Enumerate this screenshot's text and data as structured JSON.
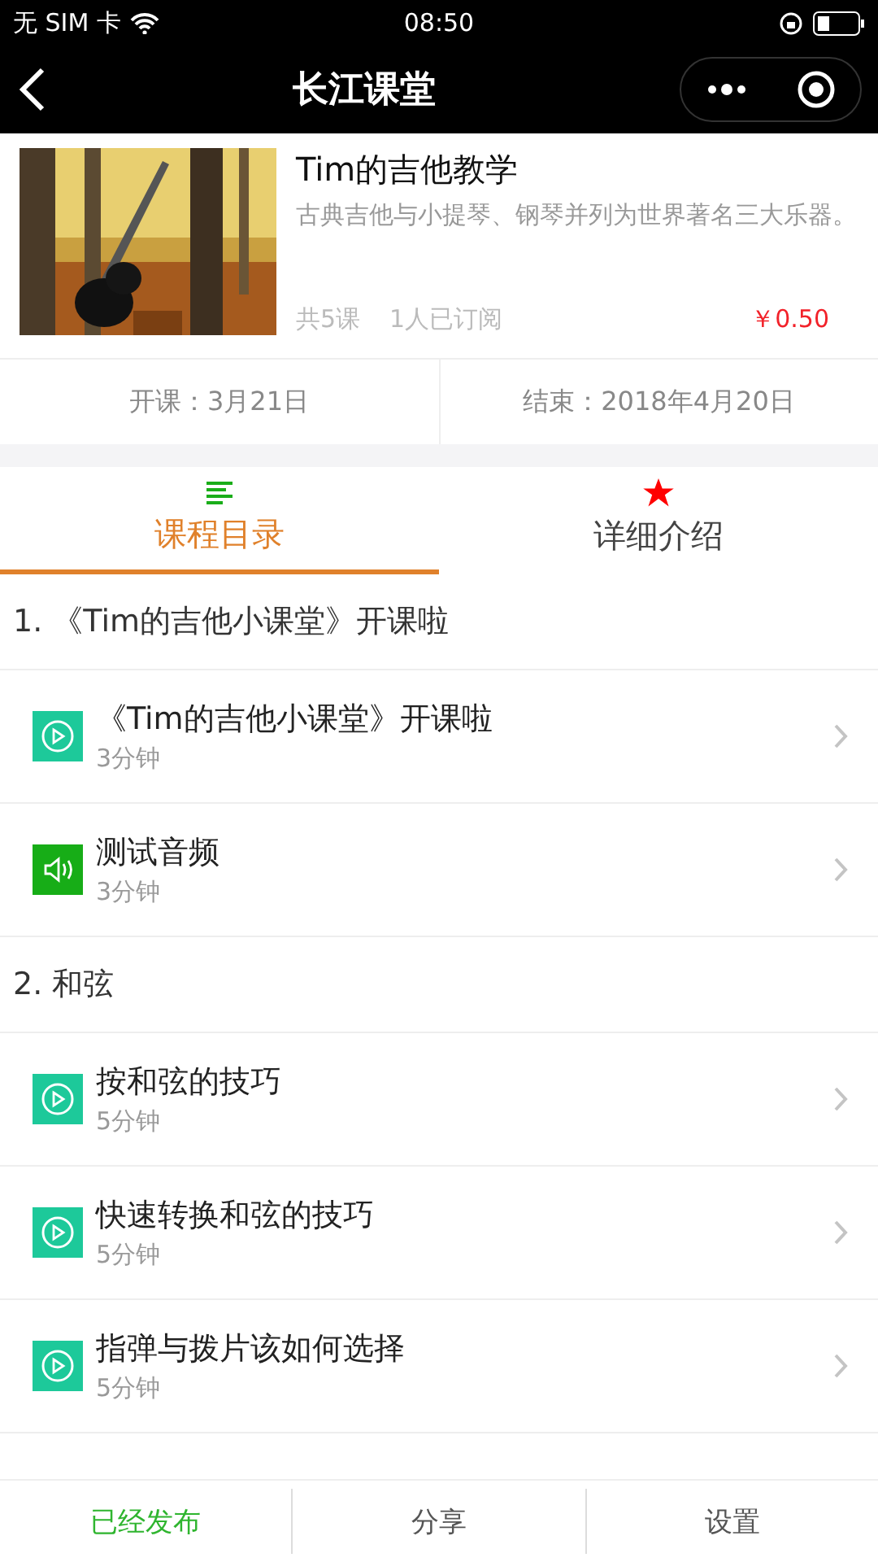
{
  "status_bar": {
    "carrier": "无 SIM 卡",
    "time": "08:50"
  },
  "nav": {
    "title": "长江课堂"
  },
  "course": {
    "title": "Tim的吉他教学",
    "description": "古典吉他与小提琴、钢琴并列为世界著名三大乐器。",
    "lessons": "共5课",
    "subscribers": "1人已订阅",
    "price": "￥0.50"
  },
  "dates": {
    "start": "开课：3月21日",
    "end": "结束：2018年4月20日"
  },
  "tabs": [
    {
      "label": "课程目录",
      "kind": "list",
      "selected": true
    },
    {
      "label": "详细介绍",
      "kind": "star",
      "selected": false
    }
  ],
  "sections": [
    {
      "title": "1. 《Tim的吉他小课堂》开课啦",
      "items": [
        {
          "kind": "video",
          "title": "《Tim的吉他小课堂》开课啦",
          "duration": "3分钟"
        },
        {
          "kind": "audio",
          "title": "测试音频",
          "duration": "3分钟"
        }
      ]
    },
    {
      "title": "2. 和弦",
      "items": [
        {
          "kind": "video",
          "title": "按和弦的技巧",
          "duration": "5分钟"
        },
        {
          "kind": "video",
          "title": "快速转换和弦的技巧",
          "duration": "5分钟"
        },
        {
          "kind": "video",
          "title": "指弹与拨片该如何选择",
          "duration": "5分钟"
        }
      ]
    }
  ],
  "bottom_bar": [
    {
      "label": "已经发布",
      "kind": "status"
    },
    {
      "label": "分享",
      "kind": "action"
    },
    {
      "label": "设置",
      "kind": "action"
    }
  ]
}
